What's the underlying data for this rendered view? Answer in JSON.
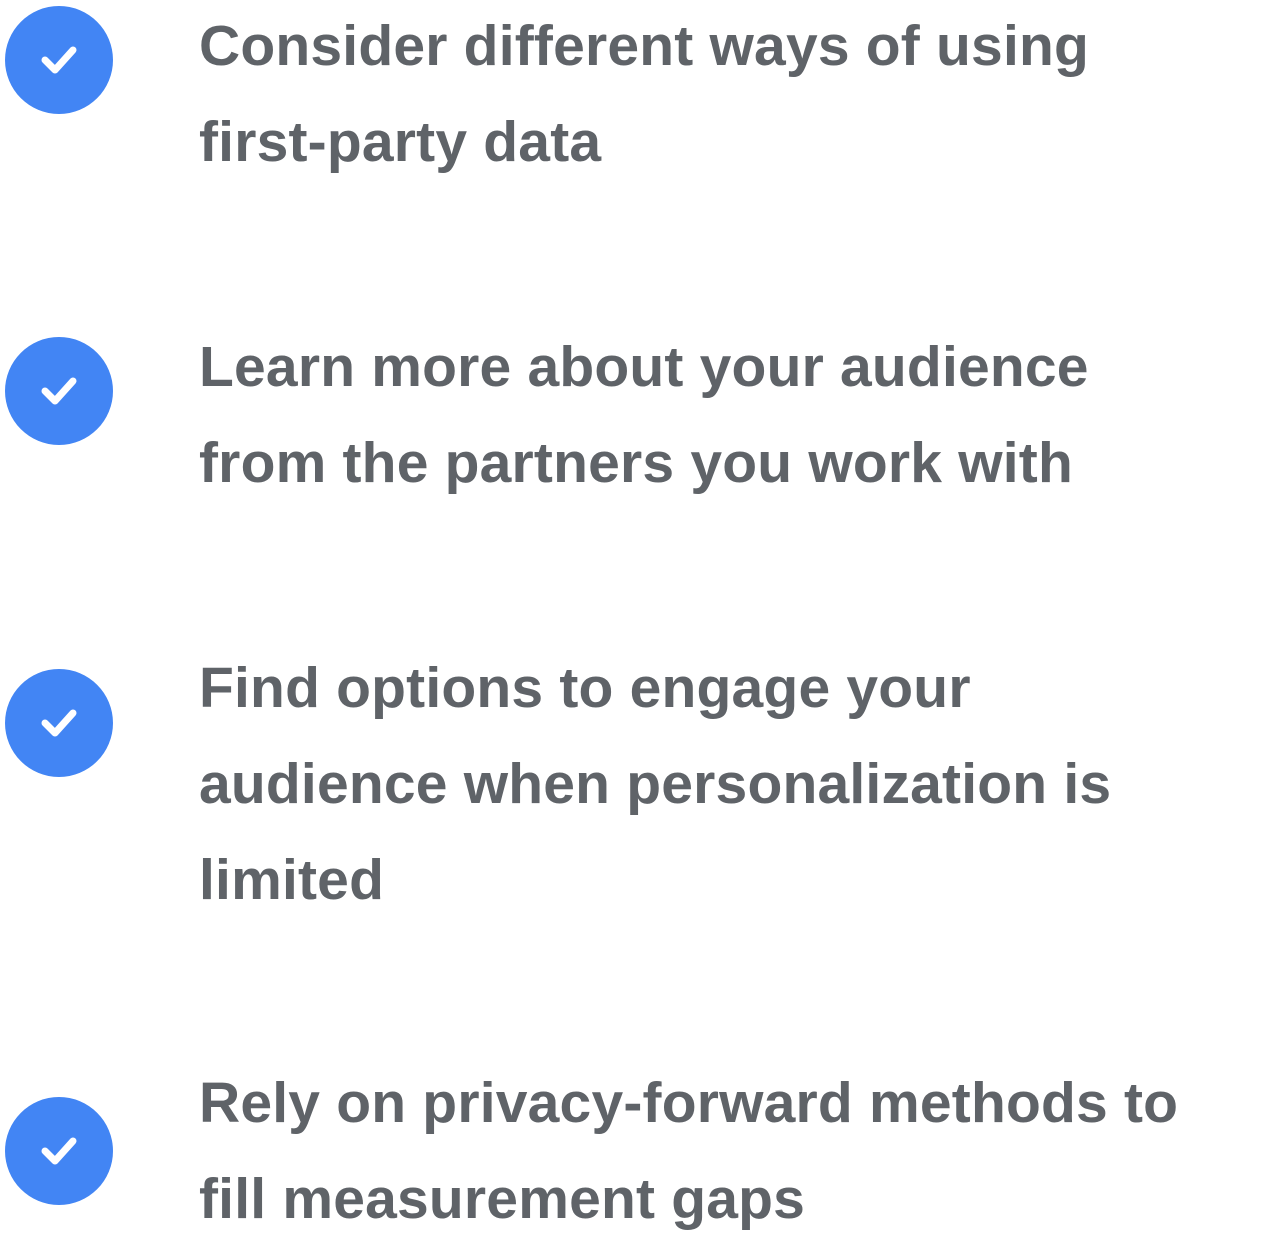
{
  "accent_color": "#4285f4",
  "text_color": "#5f6368",
  "items": [
    {
      "icon": "check-circle-icon",
      "lines": [
        "Consider different ways of using",
        "first-party data"
      ]
    },
    {
      "icon": "check-circle-icon",
      "lines": [
        "Learn more about your audience",
        "from the partners you work with"
      ]
    },
    {
      "icon": "check-circle-icon",
      "lines": [
        "Find options to engage your",
        "audience when personalization is",
        "limited"
      ]
    },
    {
      "icon": "check-circle-icon",
      "lines": [
        "Rely on privacy-forward methods to",
        "fill measurement gaps"
      ]
    }
  ]
}
